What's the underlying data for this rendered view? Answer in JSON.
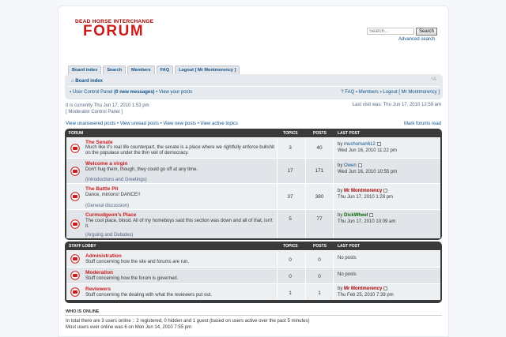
{
  "header": {
    "site_subtitle": "DEAD HORSE INTERCHANGE",
    "site_title": "FORUM",
    "search_placeholder": "Search…",
    "search_button": "Search",
    "advanced_search": "Advanced search"
  },
  "tabs": [
    "Board index",
    "Search",
    "Members",
    "FAQ",
    "Logout [ Mr Montmorency ]"
  ],
  "navbar": {
    "breadcrumb": "Board index",
    "ucp": "User Control Panel",
    "messages": "(0 new messages)",
    "view_posts": "View your posts",
    "faq": "FAQ",
    "members": "Members",
    "logout": "Logout [ Mr Montmorency ]"
  },
  "info": {
    "current_time": "It is currently Thu Jun 17, 2010 1:53 pm",
    "mcp": "[ Moderator Control Panel ]",
    "last_visit": "Last visit was: Thu Jun 17, 2010 12:59 am"
  },
  "links": {
    "unanswered": "View unanswered posts",
    "unread": "View unread posts",
    "new_posts": "View new posts",
    "active": "View active topics",
    "mark_read": "Mark forums read"
  },
  "forum_section": {
    "header": "Forum",
    "col_topics": "Topics",
    "col_posts": "Posts",
    "col_last": "Last post",
    "forums": [
      {
        "title": "The Senate",
        "desc": "Much like it's real life counterpart, the senate is a place where we rightfully enforce bullshit on the populace under the thin veil of democracy.",
        "sub": "",
        "topics": "3",
        "posts": "40",
        "last_by": "muchoman612",
        "last_time": "Wed Jun 16, 2010 11:22 pm",
        "by_color": "blue"
      },
      {
        "title": "Welcome a virgin",
        "desc": "Don't hug them, though, they could go off at any time.",
        "sub": "(Introductions and Greetings)",
        "topics": "17",
        "posts": "171",
        "last_by": "Owen",
        "last_time": "Wed Jun 16, 2010 10:55 pm",
        "by_color": "blue"
      },
      {
        "title": "The Battle Pit",
        "desc": "Dance, minions! DANCE!!",
        "sub": "(General discussion)",
        "topics": "37",
        "posts": "380",
        "last_by": "Mr Montmorency",
        "last_time": "Thu Jun 17, 2010 1:28 pm",
        "by_color": "red"
      },
      {
        "title": "Curmudgeon's Place",
        "desc": "The cool place, blood. All of my homeboys said this section was down and all of that, isn't it.",
        "sub": "(Arguing and Debates)",
        "topics": "5",
        "posts": "77",
        "last_by": "DickWheel",
        "last_time": "Thu Jun 17, 2010 10:09 am",
        "by_color": "green"
      }
    ]
  },
  "staff_section": {
    "header": "Staff Lobby",
    "col_topics": "Topics",
    "col_posts": "Posts",
    "col_last": "Last post",
    "forums": [
      {
        "title": "Administration",
        "desc": "Stuff concerning how the site and forums are run.",
        "topics": "0",
        "posts": "0",
        "no_posts": "No posts"
      },
      {
        "title": "Moderation",
        "desc": "Stuff concerning how the forum is governed.",
        "topics": "0",
        "posts": "0",
        "no_posts": "No posts"
      },
      {
        "title": "Reviewers",
        "desc": "Stuff concerning the dealing with what the reviewers put out.",
        "topics": "1",
        "posts": "1",
        "by_prefix": "by",
        "last_by": "Mr Montmorency",
        "last_time": "Thu Feb 25, 2010 7:39 pm"
      }
    ]
  },
  "who_online": {
    "title": "Who is online",
    "line1": "In total there are 3 users online :: 2 registered, 0 hidden and 1 guest (based on users active over the past 5 minutes)",
    "line2": "Most users ever online was 6 on Mon Jun 14, 2010 7:55 pm"
  },
  "colors": {
    "accent": "#cc1b1b",
    "link": "#105289",
    "table_dark": "#3a3a3a",
    "row_bg": "#ecf0f3"
  }
}
